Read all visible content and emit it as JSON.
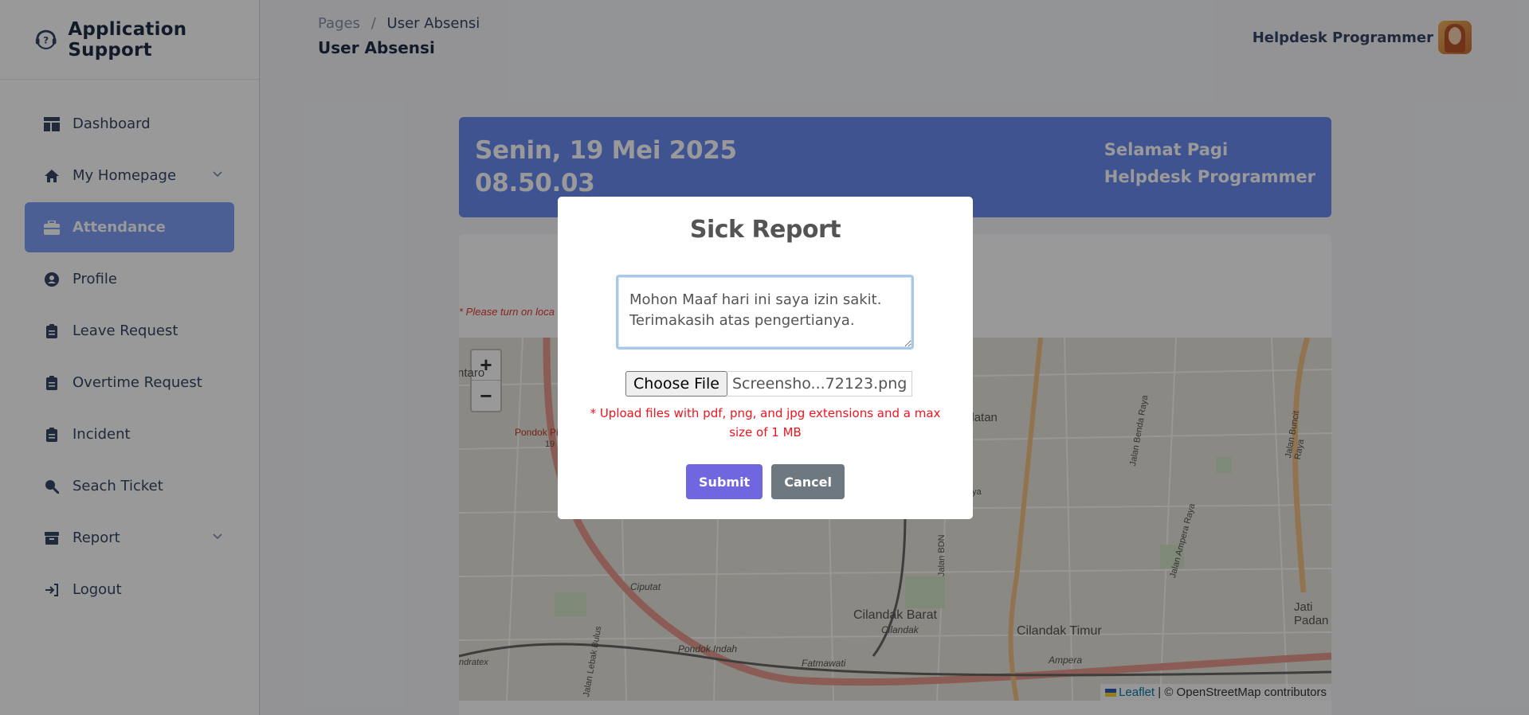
{
  "app": {
    "title": "Application Support"
  },
  "sidebar": {
    "items": [
      {
        "label": "Dashboard",
        "icon": "dashboard-icon"
      },
      {
        "label": "My Homepage",
        "icon": "home-icon",
        "expandable": true
      },
      {
        "label": "Attendance",
        "icon": "briefcase-icon",
        "active": true
      },
      {
        "label": "Profile",
        "icon": "user-circle-icon"
      },
      {
        "label": "Leave Request",
        "icon": "clipboard-icon"
      },
      {
        "label": "Overtime Request",
        "icon": "clipboard-icon"
      },
      {
        "label": "Incident",
        "icon": "clipboard-icon"
      },
      {
        "label": "Seach Ticket",
        "icon": "search-icon"
      },
      {
        "label": "Report",
        "icon": "archive-icon",
        "expandable": true
      },
      {
        "label": "Logout",
        "icon": "logout-icon"
      }
    ]
  },
  "header": {
    "breadcrumb_root": "Pages",
    "breadcrumb_sep": "/",
    "breadcrumb_current": "User Absensi",
    "page_title": "User Absensi",
    "user_name": "Helpdesk Programmer"
  },
  "banner": {
    "date": "Senin, 19 Mei 2025",
    "time": "08.50.03",
    "greeting": "Selamat Pagi",
    "greeting_name": "Helpdesk Programmer"
  },
  "card": {
    "location_warning": "* Please turn on loca"
  },
  "map": {
    "zoom_in": "+",
    "zoom_out": "−",
    "attribution_leaflet": "Leaflet",
    "attribution_rest": " | © OpenStreetMap contributors",
    "labels": [
      "ntaro",
      "Pondok Pi",
      "19",
      "Cilandak Barat",
      "Cilandak",
      "Cilandak Timur",
      "Fatmawati",
      "Ampera",
      "Jati Padan",
      "Jalan Benda Raya",
      "Jalan Ampera Raya",
      "Jalan Buncit Raya",
      "Pondok Indah",
      "Ciputat",
      "Jalan Lebak Bulus",
      "ete Selatan",
      "Jalan BDN",
      "Raya",
      "ndratex"
    ]
  },
  "modal": {
    "title": "Sick Report",
    "reason_value": "Mohon Maaf hari ini saya izin sakit.\nTerimakasih atas pengertianya.",
    "file_button": "Choose File",
    "file_name": "Screensho...72123.png",
    "upload_note": "* Upload files with pdf, png, and jpg extensions and a max size of 1 MB",
    "submit_label": "Submit",
    "cancel_label": "Cancel"
  },
  "colors": {
    "accent": "#7f9ef7",
    "banner": "#6a8bf0",
    "submit": "#7066e0",
    "cancel": "#6e7881",
    "note_red": "#f0141e"
  }
}
